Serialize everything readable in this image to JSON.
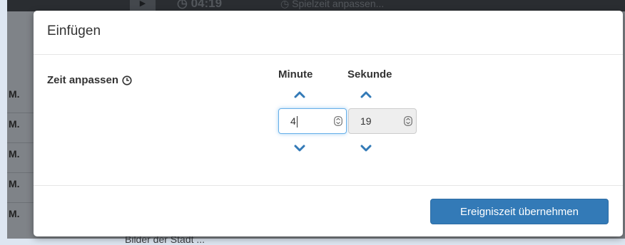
{
  "background": {
    "time_display": "04:19",
    "adjust_label": "Spielzeit anpassen...",
    "row_labels": [
      "M.",
      "M.",
      "M.",
      "M.",
      "M."
    ],
    "bottom_text": "Bilder der Stadt ..."
  },
  "modal": {
    "title": "Einfügen",
    "field_label": "Zeit anpassen",
    "minute": {
      "header": "Minute",
      "value": "4"
    },
    "second": {
      "header": "Sekunde",
      "value": "19"
    },
    "submit_label": "Ereigniszeit übernehmen"
  },
  "colors": {
    "primary": "#337ab7",
    "chevron": "#337ab7",
    "focus": "#66afe9"
  },
  "icons": {
    "clock": "clock-icon",
    "chevron_up": "chevron-up-icon",
    "chevron_down": "chevron-down-icon",
    "stepper": "stepper-icon",
    "play": "play-icon"
  }
}
